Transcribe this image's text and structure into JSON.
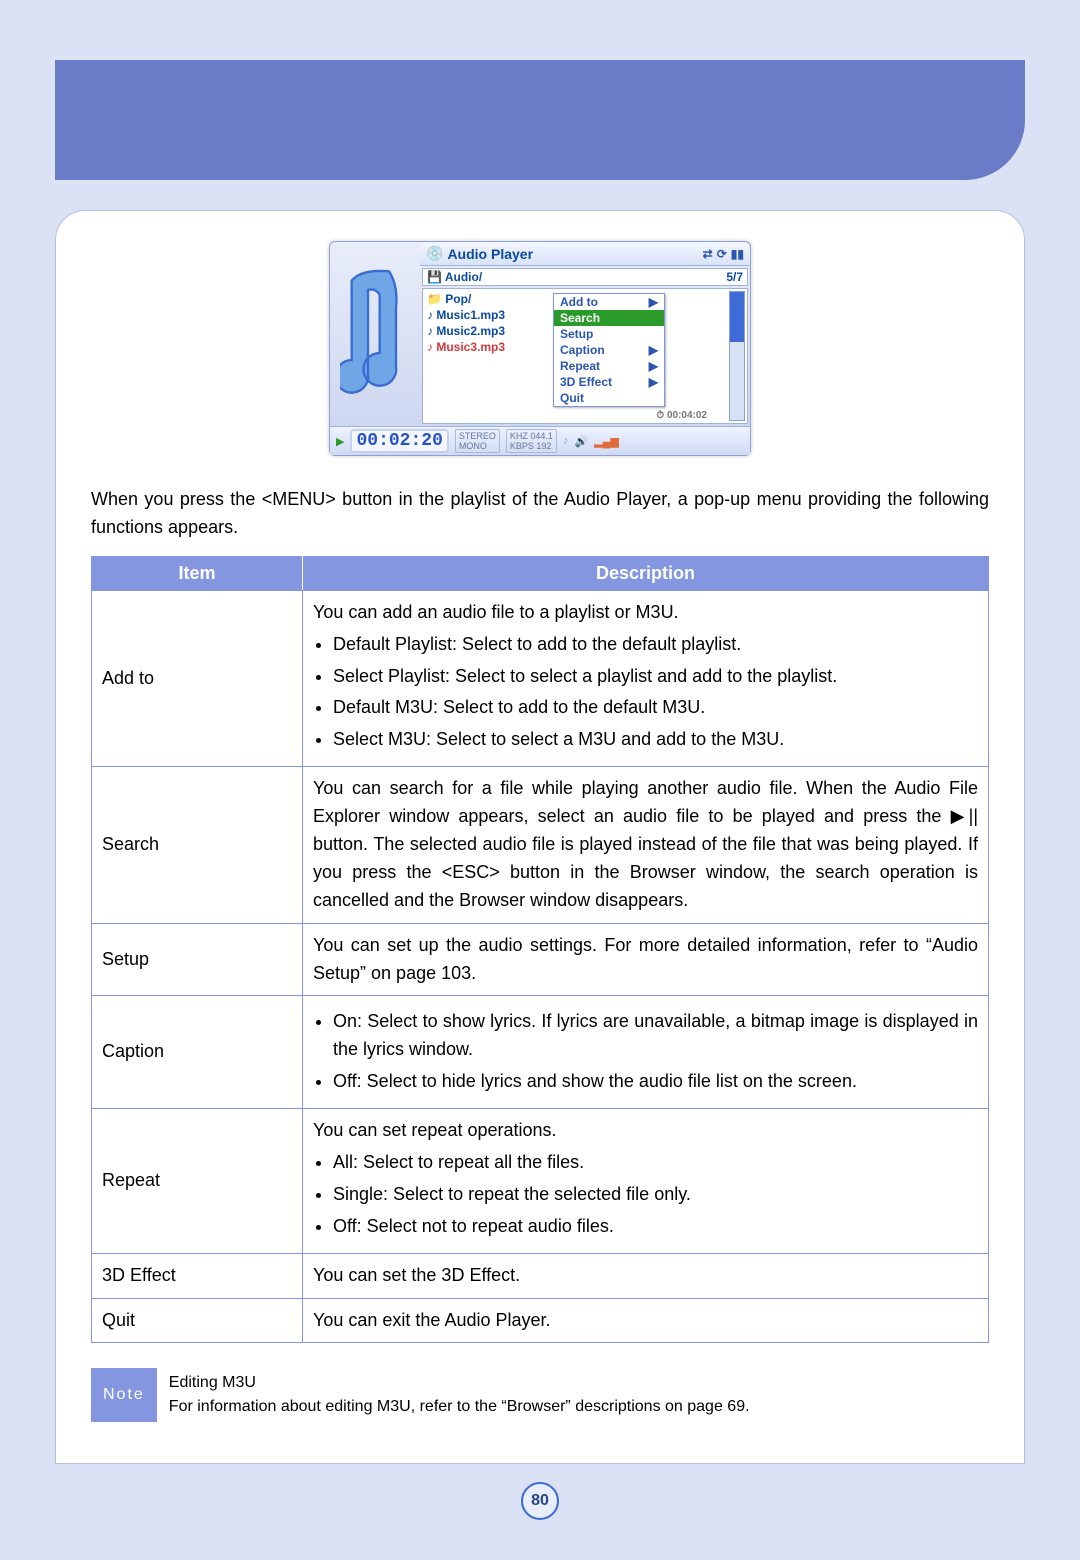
{
  "player": {
    "title": "Audio Player",
    "pathLabel": "Audio/",
    "counter": "5/7",
    "folder": "Pop/",
    "tracks": [
      "Music1.mp3",
      "Music2.mp3",
      "Music3.mp3"
    ],
    "menu": {
      "addTo": "Add to",
      "search": "Search",
      "setup": "Setup",
      "caption": "Caption",
      "repeat": "Repeat",
      "effect": "3D Effect",
      "quit": "Quit"
    },
    "duration": "00:04:02",
    "elapsed": "00:02:20",
    "mode": "STEREO",
    "mono": "MONO",
    "khz": "KHZ 044.1",
    "kbps": "KBPS 192"
  },
  "intro": "When you press the <MENU> button in the playlist of the Audio Player, a pop-up menu providing the following functions appears.",
  "headers": {
    "item": "Item",
    "desc": "Description"
  },
  "rows": {
    "addTo": {
      "item": "Add to",
      "lead": "You can add an audio file to a playlist or M3U.",
      "b1": "Default Playlist: Select to add to the default playlist.",
      "b2": "Select Playlist: Select to select a playlist and add to the playlist.",
      "b3": "Default M3U: Select to add to the default M3U.",
      "b4": "Select M3U: Select to select a M3U and add to the M3U."
    },
    "search": {
      "item": "Search",
      "text": "You can search for a file while playing another audio file. When the Audio File Explorer window appears, select an audio file to be played and press the ▶|| button. The selected audio file is played instead of the file that was being played. If you press the <ESC> button in the Browser window, the search operation is cancelled and the Browser window disappears."
    },
    "setup": {
      "item": "Setup",
      "text": "You can set up the audio settings. For more detailed information, refer to “Audio Setup” on page 103."
    },
    "caption": {
      "item": "Caption",
      "b1": "On: Select to show lyrics. If lyrics are unavailable, a bitmap image is displayed in the lyrics window.",
      "b2": "Off: Select to hide lyrics and show the audio file list on the screen."
    },
    "repeat": {
      "item": "Repeat",
      "lead": "You can set repeat operations.",
      "b1": "All: Select to repeat all the files.",
      "b2": "Single: Select to repeat the selected file only.",
      "b3": "Off: Select not to repeat audio files."
    },
    "effect": {
      "item": "3D Effect",
      "text": "You can set the 3D Effect."
    },
    "quit": {
      "item": "Quit",
      "text": "You can exit the Audio Player."
    }
  },
  "note": {
    "label": "Note",
    "title": "Editing M3U",
    "body": "For information about editing M3U, refer to the “Browser” descriptions on page 69."
  },
  "pageNumber": "80"
}
